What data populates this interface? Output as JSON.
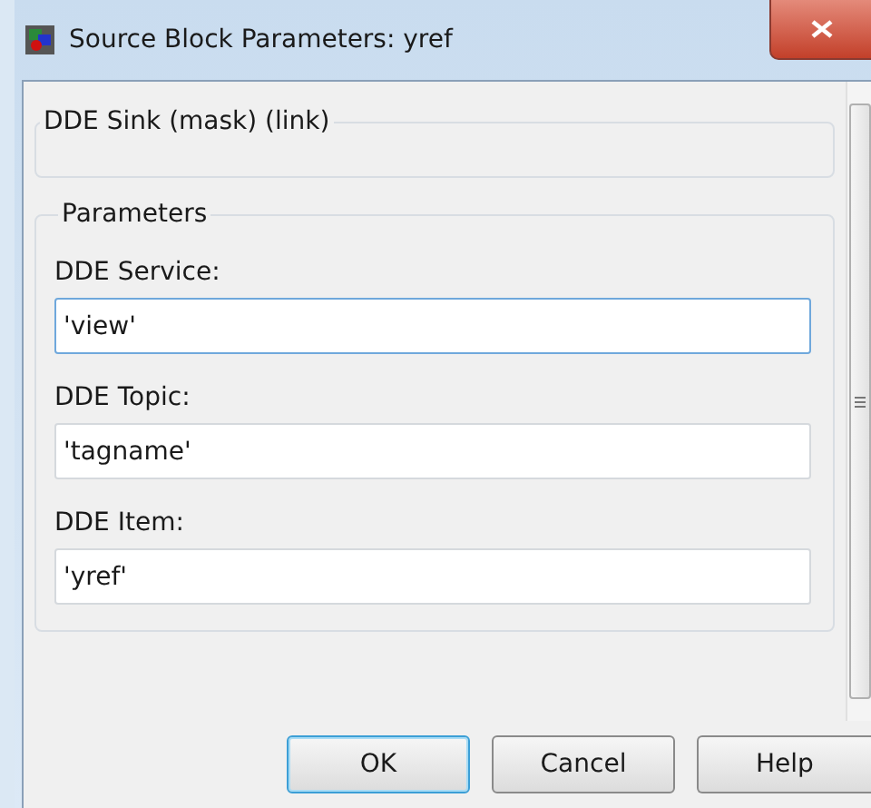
{
  "window": {
    "title": "Source Block Parameters: yref"
  },
  "description_group": {
    "title": "DDE Sink (mask) (link)"
  },
  "parameters_group": {
    "title": "Parameters",
    "fields": [
      {
        "label": "DDE Service:",
        "value": "'view'",
        "focused": true
      },
      {
        "label": "DDE Topic:",
        "value": "'tagname'",
        "focused": false
      },
      {
        "label": "DDE Item:",
        "value": "'yref'",
        "focused": false
      }
    ]
  },
  "buttons": [
    {
      "label": "OK",
      "default": true
    },
    {
      "label": "Cancel",
      "default": false
    },
    {
      "label": "Help",
      "default": false
    }
  ]
}
